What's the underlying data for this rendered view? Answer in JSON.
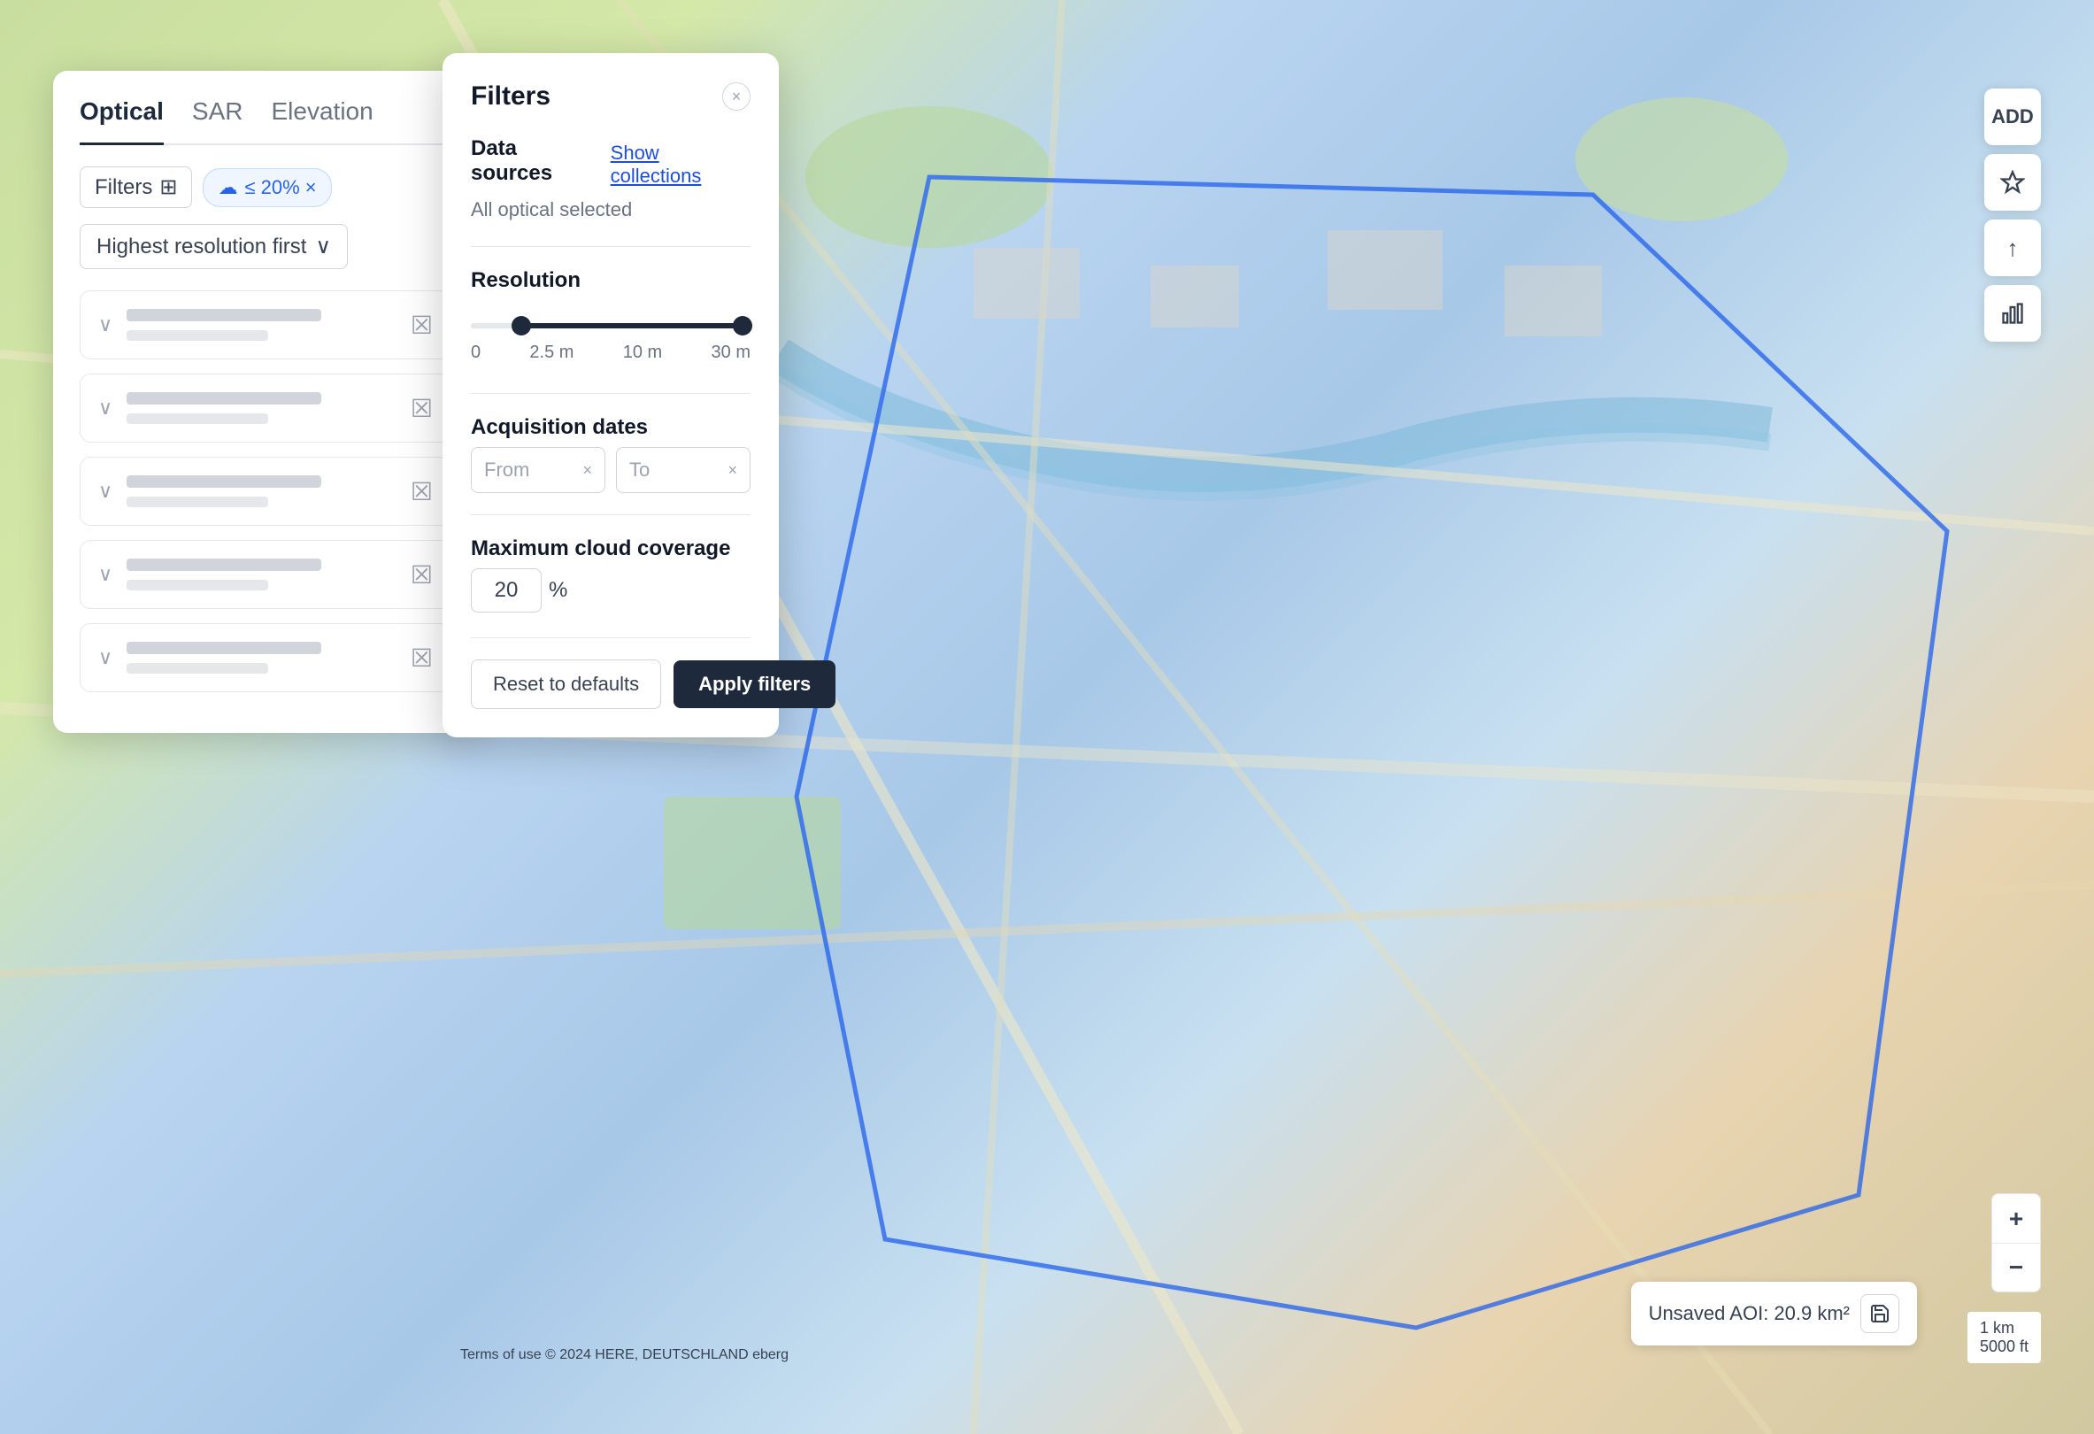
{
  "map": {
    "aoi_label": "Unsaved AOI: 20.9 km²",
    "scale_km": "1 km",
    "scale_ft": "5000 ft",
    "terms": "Terms of use © 2024 HERE, DEUTSCHLAND eberg"
  },
  "left_panel": {
    "tabs": [
      {
        "id": "optical",
        "label": "Optical",
        "active": true
      },
      {
        "id": "sar",
        "label": "SAR",
        "active": false
      },
      {
        "id": "elevation",
        "label": "Elevation",
        "active": false
      }
    ],
    "filter_badge": "Filters",
    "cloud_badge": "≤ 20% ×",
    "sort_label": "Highest resolution first",
    "list_items": [
      {
        "id": 1
      },
      {
        "id": 2
      },
      {
        "id": 3
      },
      {
        "id": 4
      },
      {
        "id": 5
      }
    ]
  },
  "filters_modal": {
    "title": "Filters",
    "close_icon": "×",
    "data_sources_label": "Data sources",
    "show_collections_label": "Show collections",
    "all_optical": "All optical selected",
    "resolution_label": "Resolution",
    "slider_marks": [
      "0",
      "2.5 m",
      "10 m",
      "30 m"
    ],
    "acquisition_dates_label": "Acquisition dates",
    "from_placeholder": "From",
    "to_placeholder": "To",
    "cloud_coverage_label": "Maximum cloud coverage",
    "cloud_value": "20",
    "cloud_unit": "%",
    "reset_label": "Reset to defaults",
    "apply_label": "Apply filters"
  },
  "toolbar": {
    "add_label": "ADD",
    "upload_icon": "↑",
    "chart_icon": "▦"
  },
  "zoom": {
    "plus": "+",
    "minus": "−"
  }
}
